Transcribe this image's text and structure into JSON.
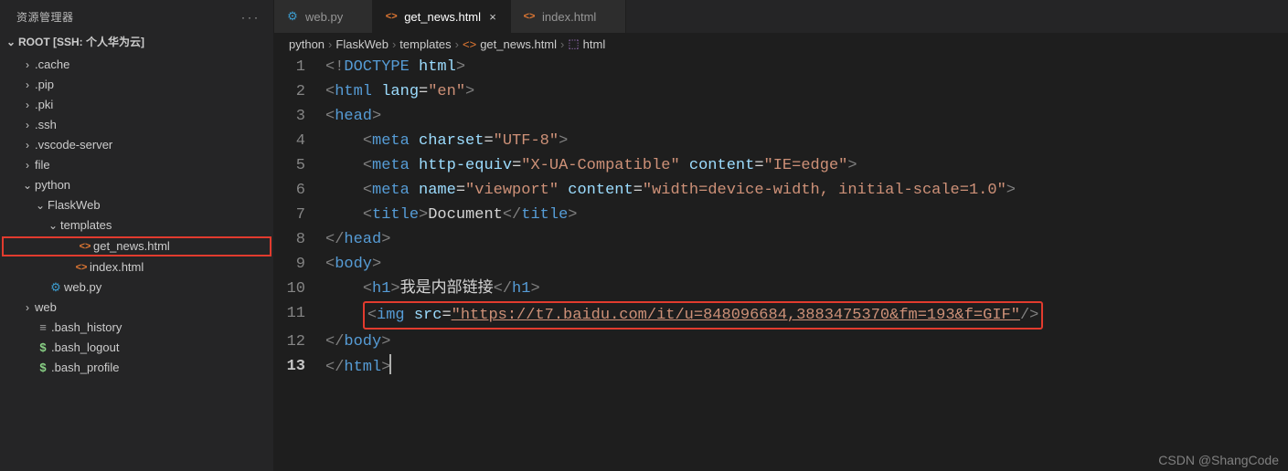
{
  "sidebar": {
    "header": "资源管理器",
    "root_title": "ROOT [SSH: 个人华为云]",
    "items": [
      {
        "name": ".cache",
        "kind": "folder",
        "depth": 1,
        "chev": "›"
      },
      {
        "name": ".pip",
        "kind": "folder",
        "depth": 1,
        "chev": "›"
      },
      {
        "name": ".pki",
        "kind": "folder",
        "depth": 1,
        "chev": "›"
      },
      {
        "name": ".ssh",
        "kind": "folder",
        "depth": 1,
        "chev": "›"
      },
      {
        "name": ".vscode-server",
        "kind": "folder",
        "depth": 1,
        "chev": "›"
      },
      {
        "name": "file",
        "kind": "folder",
        "depth": 1,
        "chev": "›"
      },
      {
        "name": "python",
        "kind": "folder",
        "depth": 1,
        "chev": "⌄"
      },
      {
        "name": "FlaskWeb",
        "kind": "folder",
        "depth": 2,
        "chev": "⌄"
      },
      {
        "name": "templates",
        "kind": "folder",
        "depth": 3,
        "chev": "⌄"
      },
      {
        "name": "get_news.html",
        "kind": "html",
        "depth": 4,
        "chev": "",
        "highlight": true
      },
      {
        "name": "index.html",
        "kind": "html",
        "depth": 4,
        "chev": ""
      },
      {
        "name": "web.py",
        "kind": "py",
        "depth": 2,
        "chev": ""
      },
      {
        "name": "web",
        "kind": "folder",
        "depth": 1,
        "chev": "›"
      },
      {
        "name": ".bash_history",
        "kind": "list",
        "depth": 1,
        "chev": ""
      },
      {
        "name": ".bash_logout",
        "kind": "dollar",
        "depth": 1,
        "chev": ""
      },
      {
        "name": ".bash_profile",
        "kind": "dollar",
        "depth": 1,
        "chev": ""
      }
    ]
  },
  "tabs": [
    {
      "label": "web.py",
      "icon": "py",
      "active": false
    },
    {
      "label": "get_news.html",
      "icon": "html",
      "active": true
    },
    {
      "label": "index.html",
      "icon": "html",
      "active": false
    }
  ],
  "breadcrumb": [
    {
      "text": "python",
      "icon": ""
    },
    {
      "text": "FlaskWeb",
      "icon": ""
    },
    {
      "text": "templates",
      "icon": ""
    },
    {
      "text": "get_news.html",
      "icon": "html"
    },
    {
      "text": "html",
      "icon": "cube"
    }
  ],
  "code": {
    "lines": [
      [
        {
          "t": "<!",
          "c": "gray"
        },
        {
          "t": "DOCTYPE",
          "c": "blue"
        },
        {
          "t": " ",
          "c": "text"
        },
        {
          "t": "html",
          "c": "lblue"
        },
        {
          "t": ">",
          "c": "gray"
        }
      ],
      [
        {
          "t": "<",
          "c": "gray"
        },
        {
          "t": "html",
          "c": "blue"
        },
        {
          "t": " ",
          "c": "text"
        },
        {
          "t": "lang",
          "c": "lblue"
        },
        {
          "t": "=",
          "c": "text"
        },
        {
          "t": "\"en\"",
          "c": "str"
        },
        {
          "t": ">",
          "c": "gray"
        }
      ],
      [
        {
          "t": "<",
          "c": "gray"
        },
        {
          "t": "head",
          "c": "blue"
        },
        {
          "t": ">",
          "c": "gray"
        }
      ],
      [
        {
          "t": "    ",
          "c": "text"
        },
        {
          "t": "<",
          "c": "gray"
        },
        {
          "t": "meta",
          "c": "blue"
        },
        {
          "t": " ",
          "c": "text"
        },
        {
          "t": "charset",
          "c": "lblue"
        },
        {
          "t": "=",
          "c": "text"
        },
        {
          "t": "\"UTF-8\"",
          "c": "str"
        },
        {
          "t": ">",
          "c": "gray"
        }
      ],
      [
        {
          "t": "    ",
          "c": "text"
        },
        {
          "t": "<",
          "c": "gray"
        },
        {
          "t": "meta",
          "c": "blue"
        },
        {
          "t": " ",
          "c": "text"
        },
        {
          "t": "http-equiv",
          "c": "lblue"
        },
        {
          "t": "=",
          "c": "text"
        },
        {
          "t": "\"X-UA-Compatible\"",
          "c": "str"
        },
        {
          "t": " ",
          "c": "text"
        },
        {
          "t": "content",
          "c": "lblue"
        },
        {
          "t": "=",
          "c": "text"
        },
        {
          "t": "\"IE=edge\"",
          "c": "str"
        },
        {
          "t": ">",
          "c": "gray"
        }
      ],
      [
        {
          "t": "    ",
          "c": "text"
        },
        {
          "t": "<",
          "c": "gray"
        },
        {
          "t": "meta",
          "c": "blue"
        },
        {
          "t": " ",
          "c": "text"
        },
        {
          "t": "name",
          "c": "lblue"
        },
        {
          "t": "=",
          "c": "text"
        },
        {
          "t": "\"viewport\"",
          "c": "str"
        },
        {
          "t": " ",
          "c": "text"
        },
        {
          "t": "content",
          "c": "lblue"
        },
        {
          "t": "=",
          "c": "text"
        },
        {
          "t": "\"width=device-width, initial-scale=1.0\"",
          "c": "str"
        },
        {
          "t": ">",
          "c": "gray"
        }
      ],
      [
        {
          "t": "    ",
          "c": "text"
        },
        {
          "t": "<",
          "c": "gray"
        },
        {
          "t": "title",
          "c": "blue"
        },
        {
          "t": ">",
          "c": "gray"
        },
        {
          "t": "Document",
          "c": "text"
        },
        {
          "t": "</",
          "c": "gray"
        },
        {
          "t": "title",
          "c": "blue"
        },
        {
          "t": ">",
          "c": "gray"
        }
      ],
      [
        {
          "t": "</",
          "c": "gray"
        },
        {
          "t": "head",
          "c": "blue"
        },
        {
          "t": ">",
          "c": "gray"
        }
      ],
      [
        {
          "t": "<",
          "c": "gray"
        },
        {
          "t": "body",
          "c": "blue"
        },
        {
          "t": ">",
          "c": "gray"
        }
      ],
      [
        {
          "t": "    ",
          "c": "text"
        },
        {
          "t": "<",
          "c": "gray"
        },
        {
          "t": "h1",
          "c": "blue"
        },
        {
          "t": ">",
          "c": "gray"
        },
        {
          "t": "我是内部链接",
          "c": "text"
        },
        {
          "t": "</",
          "c": "gray"
        },
        {
          "t": "h1",
          "c": "blue"
        },
        {
          "t": ">",
          "c": "gray"
        }
      ],
      [
        {
          "t": "    ",
          "c": "text"
        },
        {
          "boxStart": true
        },
        {
          "t": "<",
          "c": "gray"
        },
        {
          "t": "img",
          "c": "blue"
        },
        {
          "t": " ",
          "c": "text"
        },
        {
          "t": "src",
          "c": "lblue"
        },
        {
          "t": "=",
          "c": "text"
        },
        {
          "t": "\"https://t7.baidu.com/it/u=848096684,3883475370&fm=193&f=GIF\"",
          "c": "str underline-str"
        },
        {
          "t": "/>",
          "c": "gray"
        },
        {
          "boxEnd": true
        }
      ],
      [
        {
          "t": "</",
          "c": "gray"
        },
        {
          "t": "body",
          "c": "blue"
        },
        {
          "t": ">",
          "c": "gray"
        }
      ],
      [
        {
          "t": "</",
          "c": "gray"
        },
        {
          "t": "html",
          "c": "blue"
        },
        {
          "t": ">",
          "c": "gray"
        },
        {
          "cursor": true
        }
      ]
    ],
    "current_line": 13
  },
  "watermark": "CSDN @ShangCode"
}
